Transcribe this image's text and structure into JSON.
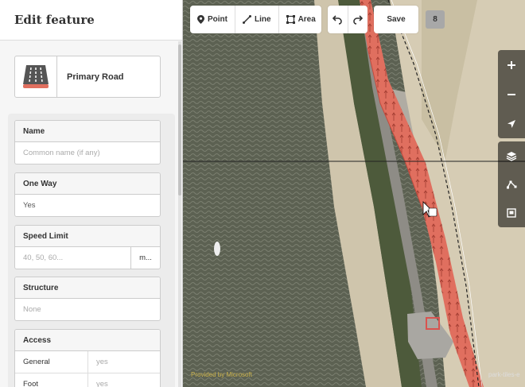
{
  "sidebar": {
    "title": "Edit feature",
    "preset": {
      "name": "Primary Road",
      "icon": "primary-road-icon"
    },
    "fields": {
      "name": {
        "label": "Name",
        "placeholder": "Common name (if any)"
      },
      "oneway": {
        "label": "One Way",
        "value": "Yes"
      },
      "speed": {
        "label": "Speed Limit",
        "placeholder": "40, 50, 60...",
        "unit": "m..."
      },
      "structure": {
        "label": "Structure",
        "placeholder": "None"
      },
      "access": {
        "label": "Access",
        "rows": [
          {
            "key": "General",
            "placeholder": "yes"
          },
          {
            "key": "Foot",
            "placeholder": "yes"
          }
        ]
      }
    }
  },
  "toolbar": {
    "point_label": "Point",
    "line_label": "Line",
    "area_label": "Area",
    "save_label": "Save",
    "count": "8"
  },
  "map": {
    "attribution_left": "Provided by Microsoft",
    "attribution_right": "park-tiles-e",
    "road_color": "#e06f5f"
  }
}
